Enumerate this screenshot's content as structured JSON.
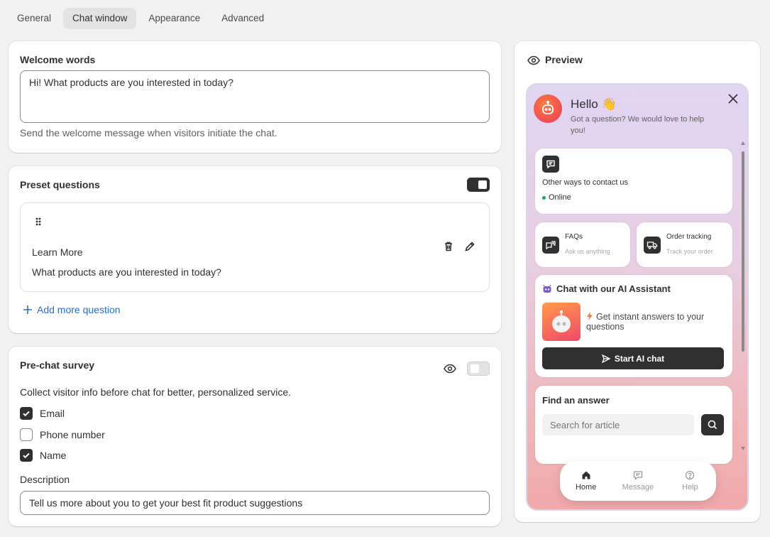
{
  "tabs": [
    {
      "label": "General",
      "active": false
    },
    {
      "label": "Chat window",
      "active": true
    },
    {
      "label": "Appearance",
      "active": false
    },
    {
      "label": "Advanced",
      "active": false
    }
  ],
  "welcome": {
    "title": "Welcome words",
    "value": "Hi! What products are you interested in today?",
    "help": "Send the welcome message when visitors initiate the chat."
  },
  "preset": {
    "title": "Preset questions",
    "enabled": true,
    "question": {
      "title": "Learn More",
      "text": "What products are you interested in today?"
    },
    "add_label": "Add more question"
  },
  "survey": {
    "title": "Pre-chat survey",
    "enabled": false,
    "intro": "Collect visitor info before chat for better, personalized service.",
    "fields": [
      {
        "label": "Email",
        "checked": true
      },
      {
        "label": "Phone number",
        "checked": false
      },
      {
        "label": "Name",
        "checked": true
      }
    ],
    "description_label": "Description",
    "description_value": "Tell us more about you to get your best fit product suggestions"
  },
  "preview": {
    "title": "Preview",
    "hello": "Hello 👋",
    "hello_sub": "Got a question? We would love to help you!",
    "contact": {
      "label": "Other ways to contact us",
      "status": "Online",
      "status_color": "#2a9d5f"
    },
    "faqs": {
      "title": "FAQs",
      "sub": "Ask us anything"
    },
    "order": {
      "title": "Order tracking",
      "sub": "Track your order"
    },
    "ai": {
      "title": "Chat with our AI Assistant",
      "desc": "Get instant answers to your questions",
      "button": "Start AI chat"
    },
    "find": {
      "title": "Find an answer",
      "placeholder": "Search for article"
    },
    "nav": [
      {
        "label": "Home",
        "icon": "home-icon",
        "active": true
      },
      {
        "label": "Message",
        "icon": "message-icon",
        "active": false
      },
      {
        "label": "Help",
        "icon": "help-icon",
        "active": false
      }
    ]
  },
  "colors": {
    "accent": "#2c6ecb",
    "dark": "#303030"
  }
}
